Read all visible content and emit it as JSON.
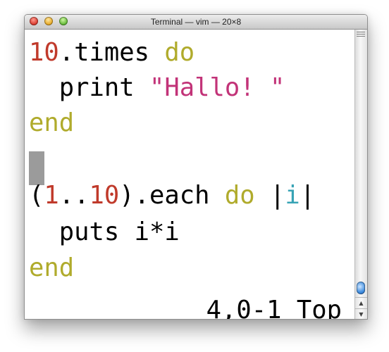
{
  "window": {
    "title": "Terminal — vim — 20×8"
  },
  "code": {
    "line1": {
      "num": "10",
      "rest": ".times ",
      "kw": "do"
    },
    "line2": {
      "indent": "  ",
      "fn": "print ",
      "str": "\"Hallo! \""
    },
    "line3": {
      "kw": "end"
    },
    "line5": {
      "open": "(",
      "num1": "1",
      "dots": "..",
      "num2": "10",
      "close": ").each ",
      "kw": "do",
      "pipe1": " |",
      "var": "i",
      "pipe2": "|"
    },
    "line6": {
      "text": "  puts i*i"
    },
    "line7": {
      "kw": "end"
    }
  },
  "statusline": {
    "ruler": "4,0-1 Top"
  },
  "colors": {
    "number": "#c03a2b",
    "keyword": "#b0ab2c",
    "string": "#c23378",
    "block_var": "#37a3b5",
    "cursor": "#9b9b9b"
  },
  "icons": {
    "close": "close-icon",
    "minimize": "minimize-icon",
    "zoom": "zoom-icon",
    "scroll_up": "arrow-up-icon",
    "scroll_down": "arrow-down-icon"
  }
}
